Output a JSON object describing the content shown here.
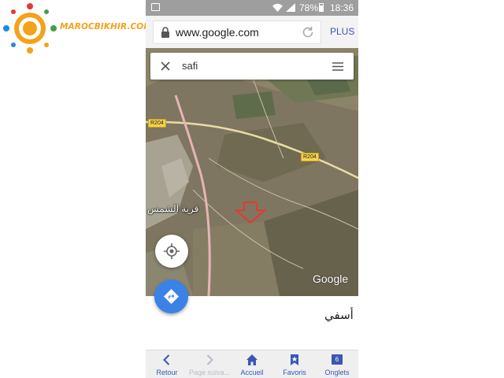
{
  "watermark": {
    "text": "MAROCBIKHIR.COM",
    "colors": [
      "#f3a21b",
      "#e53935",
      "#1e88e5",
      "#43a047"
    ]
  },
  "status_bar": {
    "battery": "78%",
    "time": "18:36",
    "icons": [
      "image-icon",
      "wifi-icon",
      "signal-icon",
      "battery-icon"
    ]
  },
  "browser": {
    "url": "www.google.com",
    "more_label": "PLUS"
  },
  "search": {
    "query": "safi"
  },
  "map": {
    "roads": [
      "R204",
      "R204"
    ],
    "place_label": "قرية الشمس",
    "brand": "Google",
    "marker_color": "#e53935"
  },
  "result": {
    "text": "أسفي"
  },
  "bottom_nav": [
    {
      "label": "Retour",
      "icon": "chevron-left-icon",
      "enabled": true
    },
    {
      "label": "Page suiva...",
      "icon": "chevron-right-icon",
      "enabled": false
    },
    {
      "label": "Accueil",
      "icon": "home-icon",
      "enabled": true
    },
    {
      "label": "Favoris",
      "icon": "bookmark-icon",
      "enabled": true
    },
    {
      "label": "Onglets",
      "icon": "tabs-icon",
      "enabled": true,
      "count": "6"
    }
  ],
  "colors": {
    "accent": "#3a57b5",
    "directions": "#3b82e6",
    "status_bar": "#9e9e9e"
  }
}
